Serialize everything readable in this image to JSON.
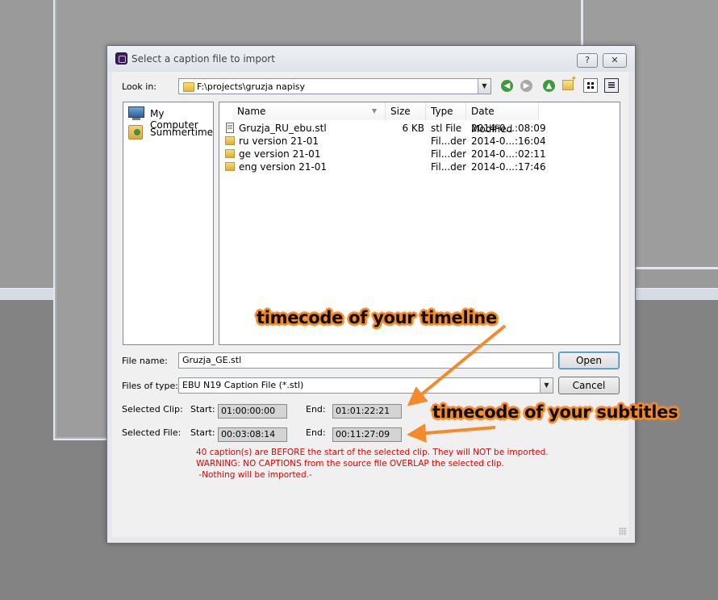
{
  "dialog": {
    "title": "Select a caption file to import",
    "help_label": "?",
    "close_label": "✕"
  },
  "lookin": {
    "label": "Look in:",
    "path": "F:\\projects\\gruzja napisy",
    "icons": [
      "back-icon",
      "forward-icon",
      "up-folder-icon",
      "new-folder-icon",
      "list-view-icon",
      "detail-view-icon"
    ]
  },
  "sidebar": {
    "items": [
      {
        "label": "My Computer",
        "icon": "computer-icon"
      },
      {
        "label": "Summertime",
        "icon": "user-folder-icon"
      }
    ]
  },
  "filelist": {
    "columns": [
      "Name",
      "Size",
      "Type",
      "Date Modified"
    ],
    "rows": [
      {
        "name": "Gruzja_RU_ebu.stl",
        "size": "6 KB",
        "type": "stl File",
        "date": "2014-0...:08:09",
        "icon": "file-icon"
      },
      {
        "name": "ru version 21-01",
        "size": "",
        "type": "Fil...der",
        "date": "2014-0...:16:04",
        "icon": "folder-icon"
      },
      {
        "name": "ge version 21-01",
        "size": "",
        "type": "Fil...der",
        "date": "2014-0...:02:11",
        "icon": "folder-icon"
      },
      {
        "name": "eng version 21-01",
        "size": "",
        "type": "Fil...der",
        "date": "2014-0...:17:46",
        "icon": "folder-icon"
      }
    ]
  },
  "form": {
    "filename_label": "File name:",
    "filename_value": "Gruzja_GE.stl",
    "filetype_label": "Files of type:",
    "filetype_value": "EBU N19 Caption File (*.stl)",
    "open_label": "Open",
    "cancel_label": "Cancel"
  },
  "timecodes": {
    "clip_label": "Selected Clip:",
    "file_label": "Selected File:",
    "start_label": "Start:",
    "end_label": "End:",
    "clip_start": "01:00:00:00",
    "clip_end": "01:01:22:21",
    "file_start": "00:03:08:14",
    "file_end": "00:11:27:09"
  },
  "messages": [
    "40 caption(s) are BEFORE the start of the selected clip. They will NOT be imported.",
    "WARNING: NO CAPTIONS from the source file OVERLAP the selected clip.",
    " -Nothing will be imported.-"
  ],
  "annotations": {
    "timeline": "timecode of your timeline",
    "subtitles": "timecode of your subtitles",
    "color": "#f48a2a"
  },
  "colors": {
    "warning_text": "#e60000",
    "accent": "#3c7fb1"
  }
}
